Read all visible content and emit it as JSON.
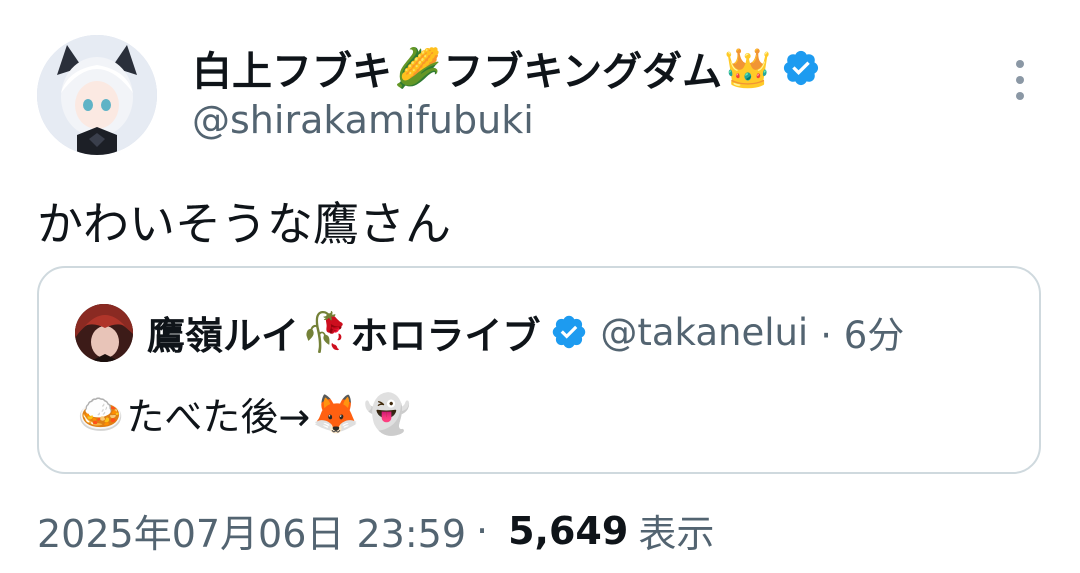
{
  "tweet": {
    "author": {
      "display_name": "白上フブキ",
      "display_name_suffix": "フブキングダム",
      "emoji_1": "🌽",
      "emoji_2": "👑",
      "handle": "@shirakamifubuki",
      "avatar_icon": "fox-girl-avatar"
    },
    "text": "かわいそうな鷹さん",
    "quote": {
      "author": {
        "display_name": "鷹嶺ルイ",
        "display_name_suffix": "ホロライブ",
        "emoji": "🥀",
        "handle": "@takanelui",
        "time": "· 6分",
        "avatar_icon": "red-hair-avatar"
      },
      "text_prefix_emoji": "🍛",
      "text": "たべた後→",
      "text_suffix_emoji_1": "🦊",
      "text_suffix_emoji_2": "👻"
    },
    "meta": {
      "timestamp": "2025年07月06日 23:59",
      "separator": "·",
      "views": "5,649",
      "views_label": "表示"
    }
  },
  "colors": {
    "verified": "#1d9bf0",
    "secondary_text": "#536471",
    "border": "#cfd9de"
  }
}
